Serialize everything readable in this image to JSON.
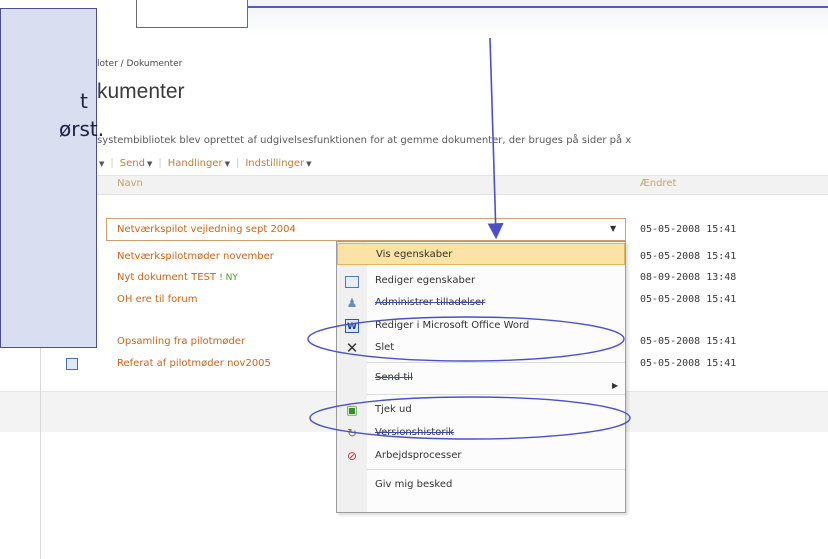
{
  "side_annotation": {
    "line1": "t",
    "line2": "ørst."
  },
  "breadcrumb": "loter / Dokumenter",
  "page_title": "kumenter",
  "description": "systembibliotek blev oprettet af udgivelsesfunktionen for at gemme dokumenter, der bruges på sider på x",
  "toolbar": {
    "send": "Send",
    "actions": "Handlinger",
    "settings": "Indstillinger"
  },
  "columns": {
    "name": "Navn",
    "changed": "Ændret"
  },
  "rows": [
    {
      "name": "Netværkspilot vejledning sept 2004",
      "changed": "05-05-2008 15:41"
    },
    {
      "name": "Netværkspilotmøder november",
      "changed": "05-05-2008 15:41"
    },
    {
      "name": "Nyt dokument TEST",
      "badge": "! NY",
      "changed": "08-09-2008 13:48"
    },
    {
      "name": "OH ere til forum",
      "changed": "05-05-2008 15:41"
    },
    {
      "name": "Opsamling fra pilotmøder",
      "changed": "05-05-2008 15:41"
    },
    {
      "name": "Referat af pilotmøder nov2005",
      "changed": "05-05-2008 15:41"
    }
  ],
  "context_menu": {
    "items": [
      {
        "label": "Vis egenskaber",
        "icon": "none"
      },
      {
        "label": "Rediger egenskaber",
        "icon": "properties-icon"
      },
      {
        "label": "Administrer tilladelser",
        "icon": "permissions-icon"
      },
      {
        "label": "Rediger i Microsoft Office Word",
        "icon": "word-icon"
      },
      {
        "label": "Slet",
        "icon": "delete-icon"
      },
      {
        "label": "Send til",
        "icon": "none"
      },
      {
        "label": "Tjek ud",
        "icon": "check-out-icon"
      },
      {
        "label": "Versionshistorik",
        "icon": "version-history-icon"
      },
      {
        "label": "Arbejdsprocesser",
        "icon": "workflow-icon"
      },
      {
        "label": "Giv mig besked",
        "icon": "none"
      }
    ]
  },
  "colors": {
    "annotation": "#4b50c8",
    "link": "#c7651d",
    "highlight": "#fbe3a6"
  }
}
